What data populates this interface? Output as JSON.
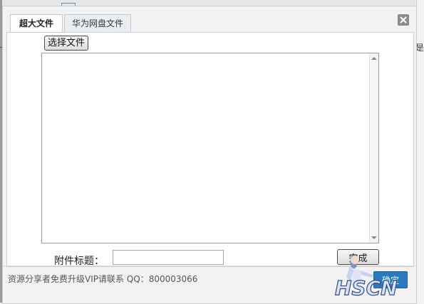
{
  "tabs": [
    {
      "label": "超大文件",
      "active": true
    },
    {
      "label": "华为网盘文件",
      "active": false
    }
  ],
  "close_icon": "close-icon",
  "upload": {
    "choose_button": "选择文件",
    "file_list": []
  },
  "attachment": {
    "title_label": "附件标题：",
    "title_value": "",
    "finish_button": "完成"
  },
  "footer": {
    "notice": "资源分享者免费升级VIP请联系 QQ：800003066",
    "confirm_button": "确定"
  },
  "colors": {
    "accent": "#2a7ac0",
    "tab_inactive_bg": "#e8eef4"
  }
}
